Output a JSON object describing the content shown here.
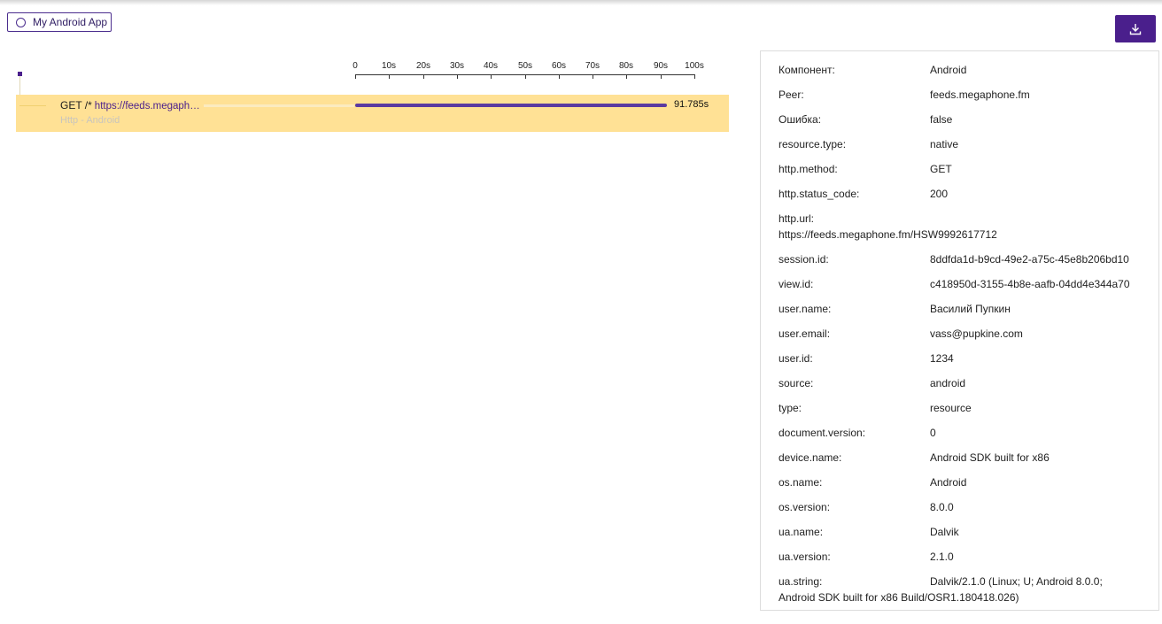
{
  "service_chip": {
    "label": "My Android App"
  },
  "colors": {
    "accent": "#4a1f8c",
    "span_highlight": "#ffe195"
  },
  "timeline": {
    "ticks": [
      "0",
      "10s",
      "20s",
      "30s",
      "40s",
      "50s",
      "60s",
      "70s",
      "80s",
      "90s",
      "100s"
    ],
    "range_seconds": [
      0,
      100
    ]
  },
  "span": {
    "method": "GET /*",
    "url": "https://feeds.megaph…",
    "subtitle": "Http - Android",
    "duration_label": "91.785s",
    "start_seconds": 0,
    "duration_seconds": 91.785
  },
  "details": [
    {
      "key": "Компонент:",
      "value": "Android"
    },
    {
      "key": "Peer:",
      "value": "feeds.megaphone.fm"
    },
    {
      "key": "Ошибка:",
      "value": "false"
    },
    {
      "key": "resource.type:",
      "value": "native"
    },
    {
      "key": "http.method:",
      "value": "GET"
    },
    {
      "key": "http.status_code:",
      "value": "200"
    },
    {
      "key": "http.url:",
      "value": "https://feeds.megaphone.fm/HSW9992617712"
    },
    {
      "key": "session.id:",
      "value": "8ddfda1d-b9cd-49e2-a75c-45e8b206bd10"
    },
    {
      "key": "view.id:",
      "value": "c418950d-3155-4b8e-aafb-04dd4e344a70"
    },
    {
      "key": "user.name:",
      "value": "Василий Пупкин"
    },
    {
      "key": "user.email:",
      "value": "vass@pupkine.com"
    },
    {
      "key": "user.id:",
      "value": "1234"
    },
    {
      "key": "source:",
      "value": "android"
    },
    {
      "key": "type:",
      "value": "resource"
    },
    {
      "key": "document.version:",
      "value": "0"
    },
    {
      "key": "device.name:",
      "value": "Android SDK built for x86"
    },
    {
      "key": "os.name:",
      "value": "Android"
    },
    {
      "key": "os.version:",
      "value": "8.0.0"
    },
    {
      "key": "ua.name:",
      "value": "Dalvik"
    },
    {
      "key": "ua.version:",
      "value": "2.1.0"
    },
    {
      "key": "ua.string:",
      "value": "Dalvik/2.1.0 (Linux; U; Android 8.0.0;",
      "value_cont": "Android SDK built for x86 Build/OSR1.180418.026)"
    }
  ]
}
